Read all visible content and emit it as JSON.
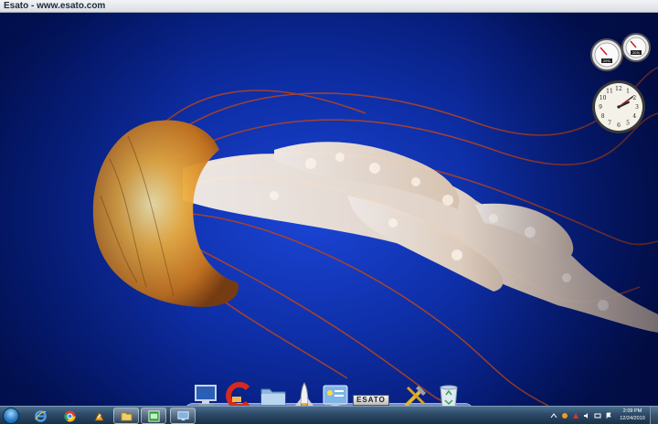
{
  "watermark": {
    "text": "Esato - www.esato.com"
  },
  "gadgets": {
    "meter": {
      "values": [
        "29%",
        "20%"
      ]
    },
    "clock": {
      "hour": 2,
      "minute": 9
    }
  },
  "dock": {
    "items": [
      {
        "name": "computer",
        "icon": "computer-icon"
      },
      {
        "name": "ccleaner",
        "icon": "ccleaner-icon"
      },
      {
        "name": "folder",
        "icon": "folder-icon"
      },
      {
        "name": "shuttle",
        "icon": "shuttle-icon"
      },
      {
        "name": "control-panel",
        "icon": "control-panel-icon"
      },
      {
        "name": "tools",
        "icon": "tools-icon"
      },
      {
        "name": "recycle-bin",
        "icon": "recycle-bin-icon"
      }
    ],
    "logo_text": "ESATO"
  },
  "taskbar": {
    "pinned": [
      {
        "name": "internet-explorer",
        "icon": "internet-explorer-icon"
      },
      {
        "name": "chrome",
        "icon": "chrome-icon"
      },
      {
        "name": "winamp",
        "icon": "winamp-icon"
      },
      {
        "name": "explorer",
        "icon": "folder-icon"
      },
      {
        "name": "green-app",
        "icon": "green-window-icon"
      },
      {
        "name": "network-app",
        "icon": "network-icon"
      }
    ],
    "time": "2:09 PM",
    "date": "12/24/2010"
  },
  "colors": {
    "desktop": "#0e2fa8",
    "taskbar": "#2c4a67",
    "jelly": "#e89a2a"
  }
}
